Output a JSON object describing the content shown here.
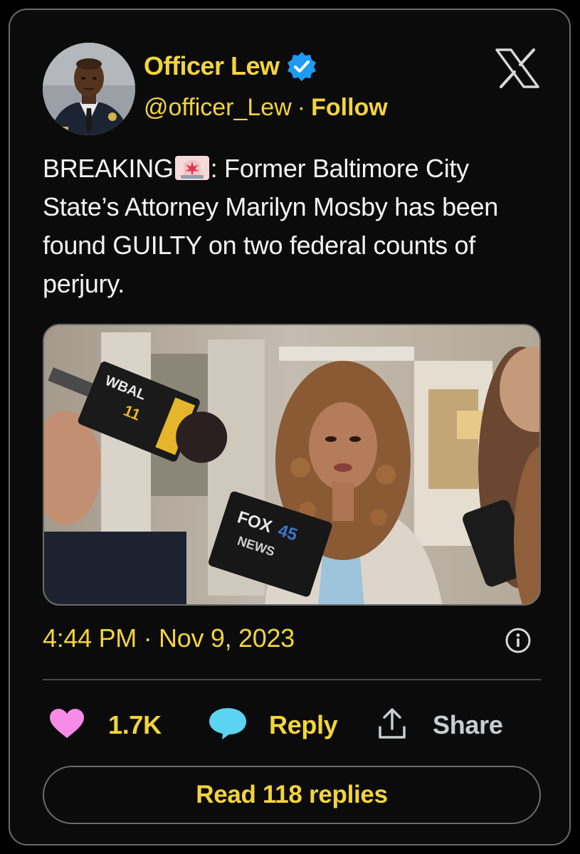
{
  "author": {
    "display_name": "Officer Lew",
    "handle": "@officer_Lew",
    "separator": "·",
    "follow_label": "Follow",
    "verified": true
  },
  "tweet": {
    "text_before_emoji": "BREAKING",
    "emoji": "siren",
    "text_after_emoji": ": Former Baltimore City State’s Attorney Marilyn Mosby has been found GUILTY on two federal counts of perjury.",
    "timestamp": "4:44 PM · Nov 9, 2023"
  },
  "media": {
    "mic_logos": [
      "WBAL TV",
      "FOX45 NEWS"
    ]
  },
  "actions": {
    "likes": "1.7K",
    "reply_label": "Reply",
    "share_label": "Share"
  },
  "read_replies_label": "Read 118 replies",
  "colors": {
    "accent": "#f3d43c",
    "background": "#0b0b0b",
    "text": "#f4f4f4",
    "heart": "#f78be8",
    "reply_bubble": "#5cd3f0",
    "verified_badge": "#1d9bf0"
  },
  "icons": {
    "platform": "x-logo",
    "verified": "verified-badge-icon",
    "info": "info-icon",
    "like": "heart-icon",
    "reply": "speech-bubble-icon",
    "share": "share-upload-icon"
  }
}
